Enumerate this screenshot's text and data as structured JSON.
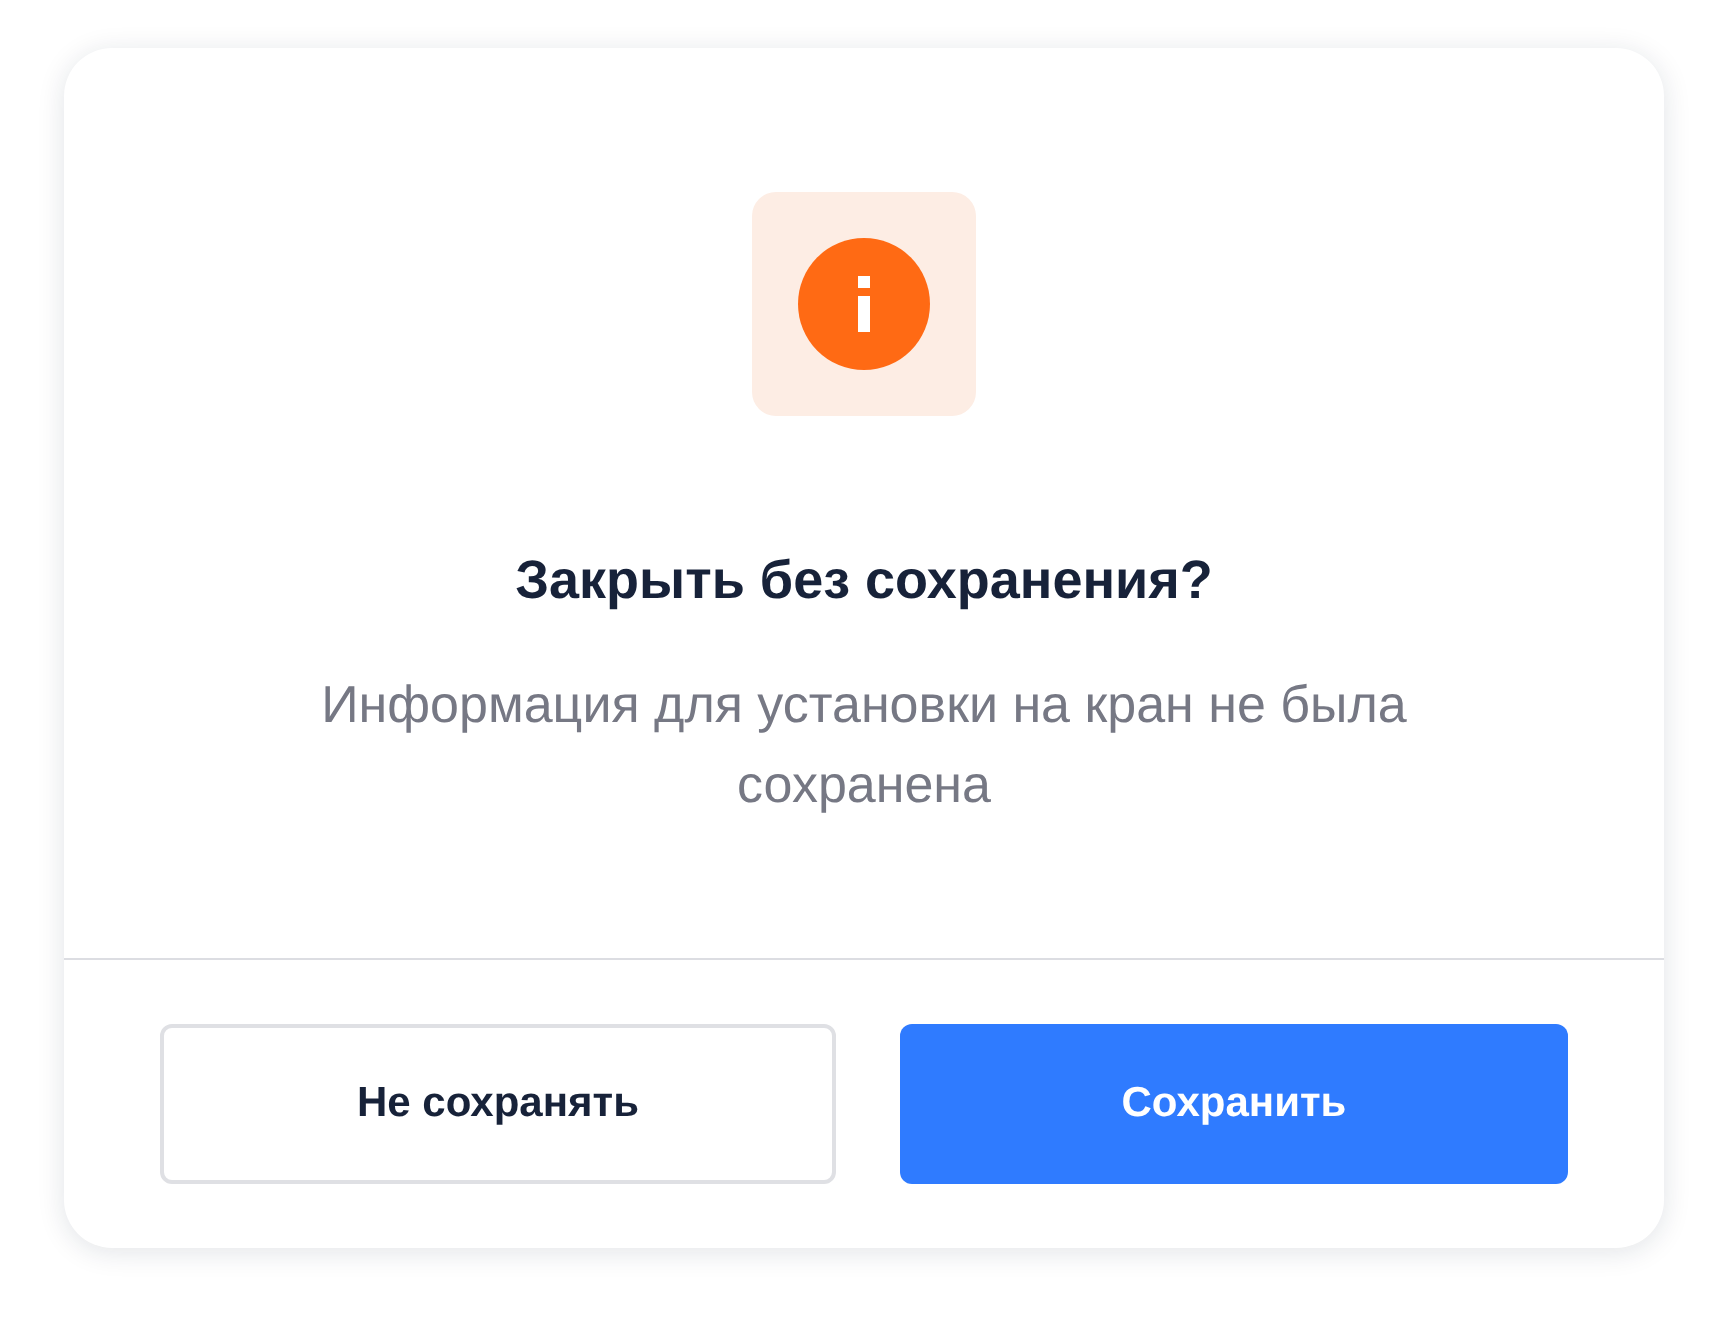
{
  "dialog": {
    "title": "Закрыть без сохранения?",
    "message": "Информация для установки на кран не была сохранена",
    "buttons": [
      {
        "label": "Не сохранять",
        "kind": "secondary"
      },
      {
        "label": "Сохранить",
        "kind": "primary"
      }
    ]
  }
}
